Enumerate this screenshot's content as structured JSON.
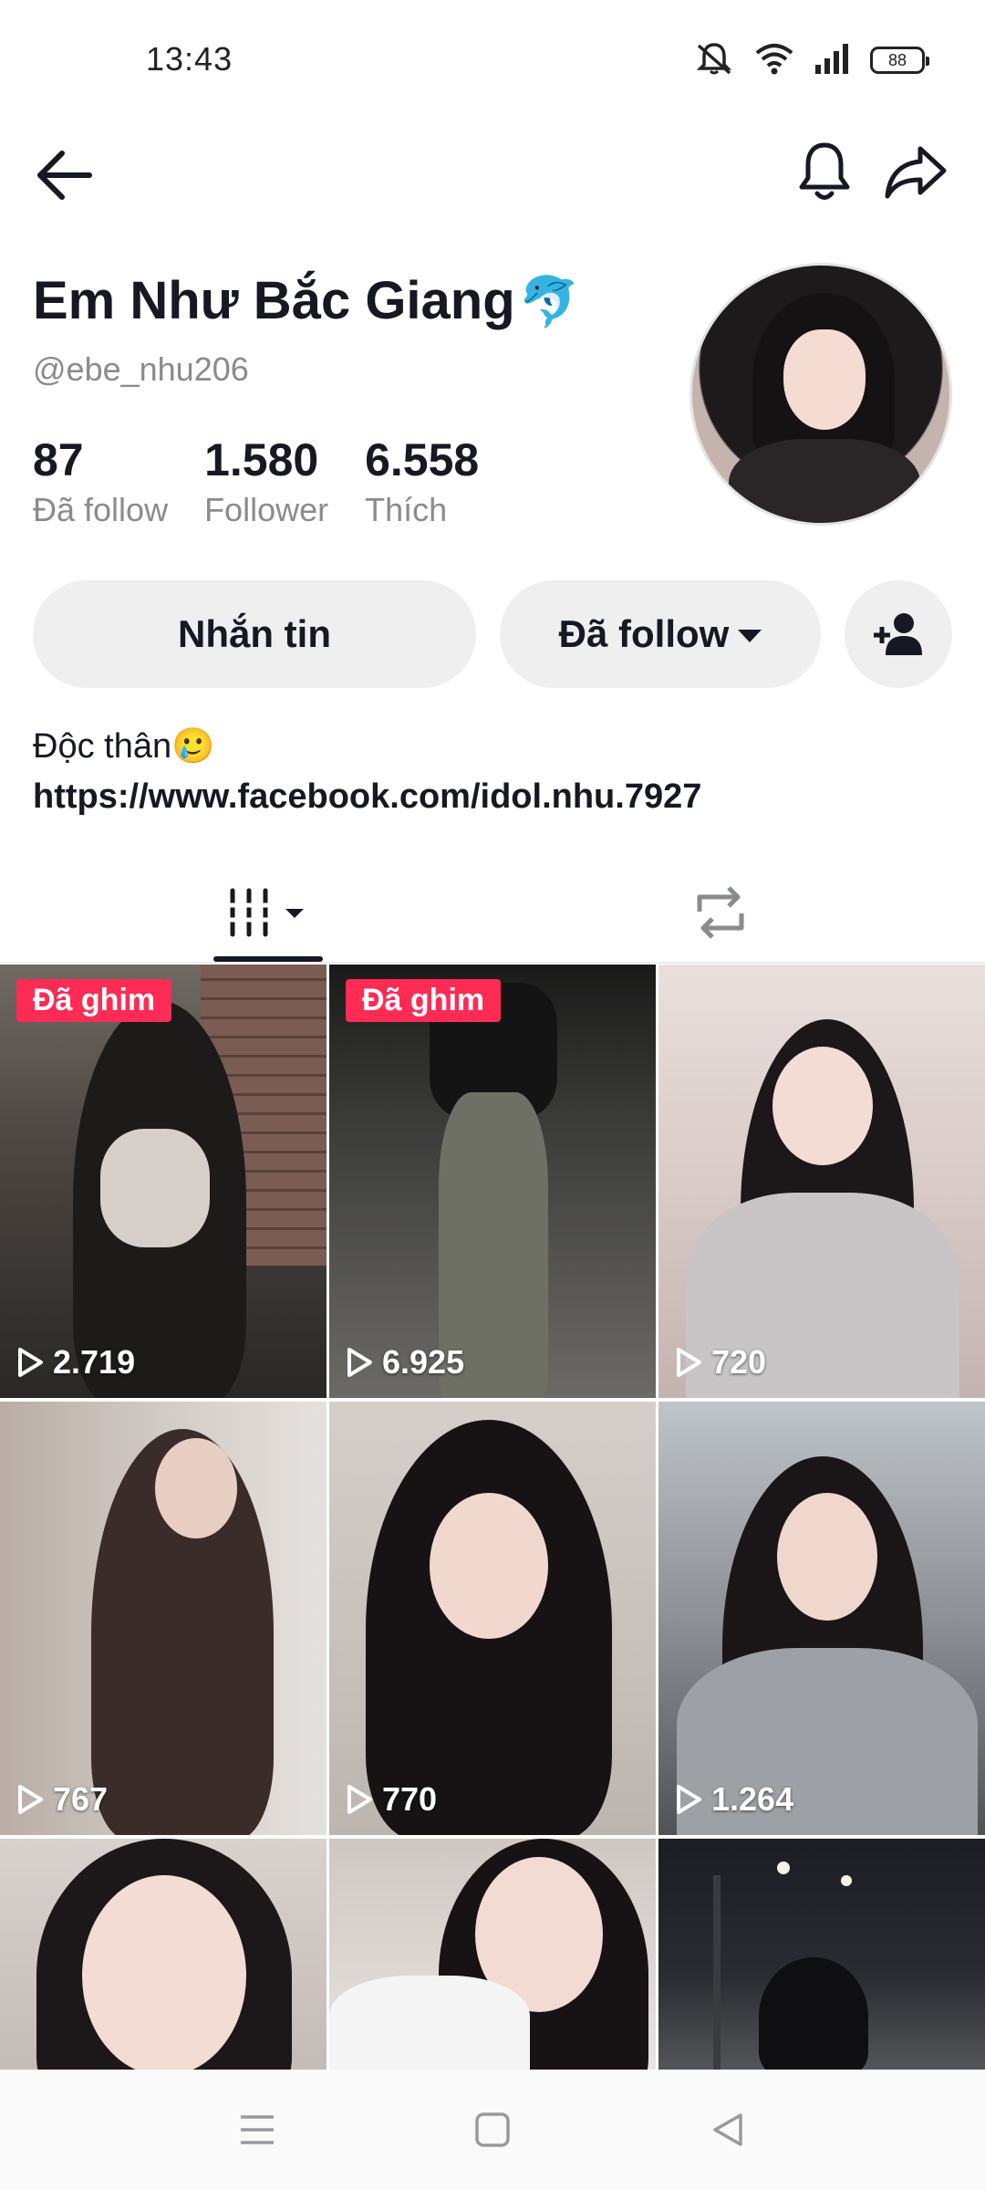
{
  "status_bar": {
    "time": "13:43",
    "battery": "88",
    "icons": [
      "mute-icon",
      "wifi-icon",
      "signal-icon",
      "battery-icon"
    ]
  },
  "nav": {
    "icons": [
      "back-arrow-icon",
      "bell-icon",
      "share-icon"
    ]
  },
  "profile": {
    "name": "Em Như Bắc Giang",
    "name_emoji": "🐬",
    "handle": "@ebe_nhu206",
    "stats": [
      {
        "value": "87",
        "label": "Đã follow"
      },
      {
        "value": "1.580",
        "label": "Follower"
      },
      {
        "value": "6.558",
        "label": "Thích"
      }
    ]
  },
  "actions": {
    "message_label": "Nhắn tin",
    "following_label": "Đã follow"
  },
  "bio": {
    "line": "Độc thân🥲",
    "link": "https://www.facebook.com/idol.nhu.7927"
  },
  "tabs": {
    "icons": [
      "videos-grid-icon",
      "repost-icon"
    ]
  },
  "videos": [
    {
      "views": "2.719",
      "pinned": "Đã ghim"
    },
    {
      "views": "6.925",
      "pinned": "Đã ghim"
    },
    {
      "views": "720"
    },
    {
      "views": "767"
    },
    {
      "views": "770"
    },
    {
      "views": "1.264"
    },
    {
      "views": ""
    },
    {
      "views": ""
    },
    {
      "views": ""
    }
  ],
  "colors": {
    "accent": "#fe2c55",
    "text": "#161823",
    "secondary_text": "#8a8b91",
    "button_bg": "#efefef"
  }
}
